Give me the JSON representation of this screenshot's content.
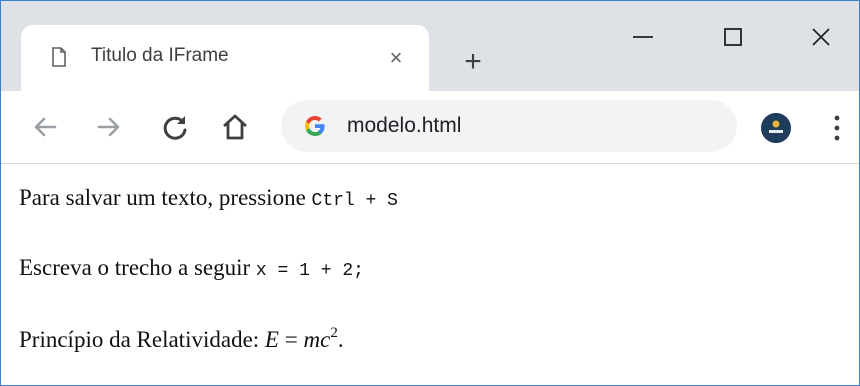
{
  "tab": {
    "title": "Titulo da IFrame",
    "close": "×"
  },
  "newtab": {
    "label": "+"
  },
  "omnibox": {
    "url": "modelo.html"
  },
  "content": {
    "line1": {
      "text": "Para salvar um texto, pressione ",
      "code": "Ctrl + S"
    },
    "line2": {
      "text": "Escreva o trecho a seguir ",
      "code": "x = 1 + 2;"
    },
    "line3": {
      "prefix": "Princípio da Relatividade: ",
      "E": "E",
      "eq": " = ",
      "m": "m",
      "c": "c",
      "exp": "2",
      "suffix": "."
    }
  },
  "colors": {
    "window_border": "#3c7fd1",
    "tabstrip": "#dee1e6",
    "omnibox": "#f1f3f4"
  },
  "icons": [
    "page-icon",
    "close-icon",
    "plus-icon",
    "minimize-icon",
    "maximize-icon",
    "window-close-icon",
    "back-icon",
    "forward-icon",
    "reload-icon",
    "home-icon",
    "google-icon",
    "profile-icon",
    "more-menu-icon"
  ]
}
